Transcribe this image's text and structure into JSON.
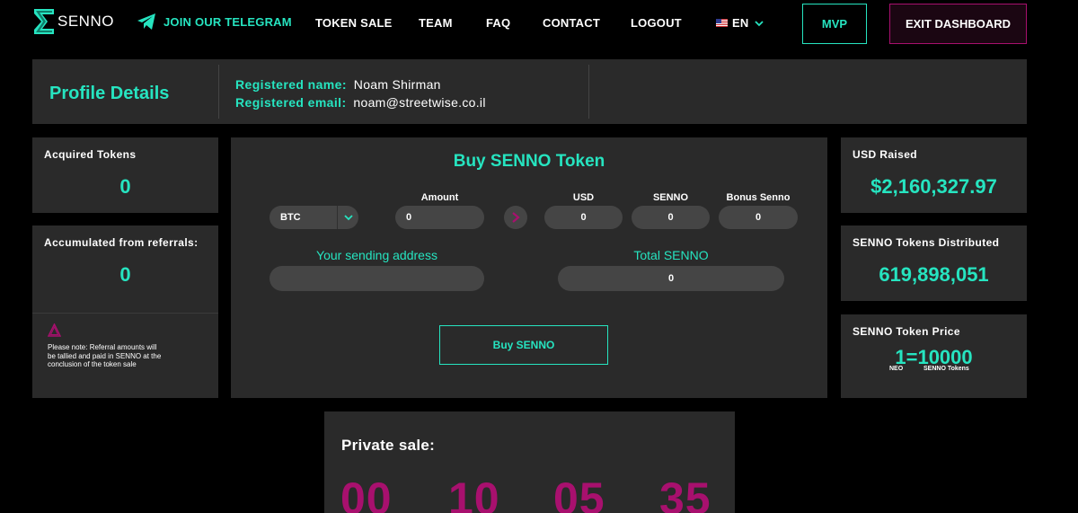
{
  "nav": {
    "logo_text": "SENNO",
    "telegram": "JOIN OUR TELEGRAM",
    "token_sale": "TOKEN SALE",
    "team": "TEAM",
    "faq": "FAQ",
    "contact": "CONTACT",
    "logout": "LOGOUT",
    "language": "EN",
    "mvp": "MVP",
    "exit": "EXIT DASHBOARD"
  },
  "profile": {
    "title": "Profile Details",
    "name_label": "Registered name:",
    "name_value": "Noam Shirman",
    "email_label": "Registered email:",
    "email_value": "noam@streetwise.co.il"
  },
  "acquired": {
    "label": "Acquired Tokens",
    "value": "0"
  },
  "referrals": {
    "label": "Accumulated from referrals:",
    "value": "0",
    "note": "Please note: Referral amounts will be tallied and paid in SENNO at the conclusion of the token sale"
  },
  "buy": {
    "title": "Buy SENNO Token",
    "currency": "BTC",
    "amount_label": "Amount",
    "amount_value": "0",
    "usd_label": "USD",
    "usd_value": "0",
    "senno_label": "SENNO",
    "senno_value": "0",
    "bonus_label": "Bonus Senno",
    "bonus_value": "0",
    "address_label": "Your sending address",
    "address_value": "",
    "total_label": "Total SENNO",
    "total_value": "0",
    "button": "Buy SENNO"
  },
  "usd_raised": {
    "label": "USD Raised",
    "value": "$2,160,327.97"
  },
  "distributed": {
    "label": "SENNO Tokens Distributed",
    "value": "619,898,051"
  },
  "price": {
    "label": "SENNO Token Price",
    "left": "1",
    "eq": "=",
    "right": "10000",
    "left_unit": "NEO",
    "right_unit": "SENNO Tokens"
  },
  "private_sale": {
    "title": "Private sale:",
    "d1": "00",
    "d2": "10",
    "d3": "05",
    "d4": "35"
  },
  "colors": {
    "accent": "#26e4c0",
    "magenta": "#a8106e",
    "panel": "#2a2a2a",
    "input": "#454545"
  },
  "icons": [
    "sigma-logo-icon",
    "telegram-plane-icon",
    "us-flag-icon",
    "chevron-down-icon",
    "warning-triangle-icon",
    "arrow-right-icon"
  ]
}
